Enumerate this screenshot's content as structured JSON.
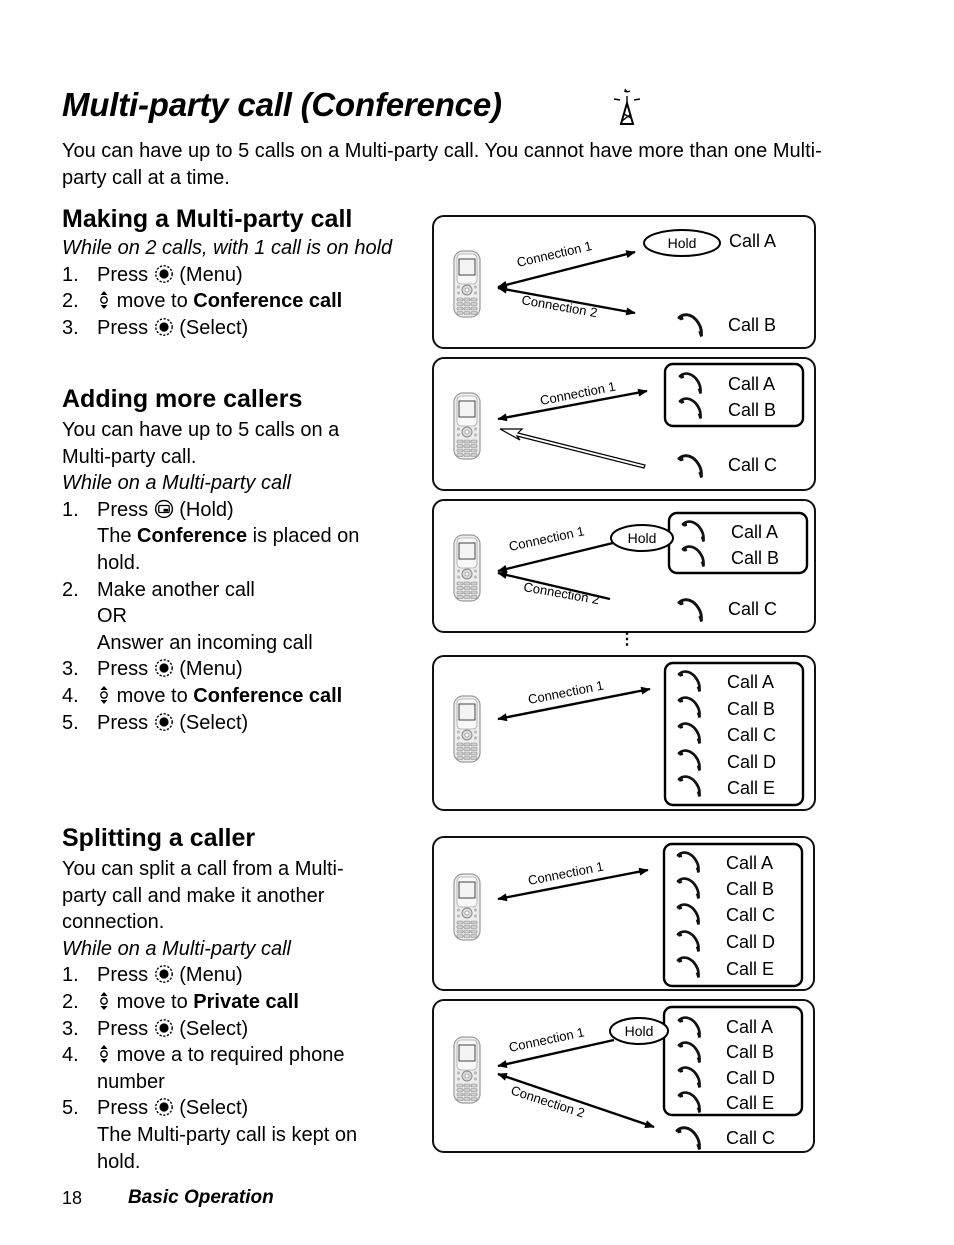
{
  "page": {
    "title": "Multi-party call (Conference)",
    "title_icon": "network-tower-icon",
    "intro": "You can have up to 5 calls on a Multi-party call. You cannot have more than one Multi-party call at a time.",
    "footer": {
      "page_number": "18",
      "section": "Basic Operation"
    }
  },
  "sections": {
    "making": {
      "heading": "Making a Multi-party call",
      "condition": "While on 2 calls, with 1 call is on hold",
      "steps": [
        {
          "num": "1.",
          "pre": "Press",
          "icon": "select-key-icon",
          "post": "(Menu)"
        },
        {
          "num": "2.",
          "icon": "nav-key-icon",
          "pre": "move to",
          "bold": "Conference call"
        },
        {
          "num": "3.",
          "pre": "Press",
          "icon": "select-key-icon",
          "post": "(Select)"
        }
      ]
    },
    "adding": {
      "heading": "Adding more callers",
      "body": "You can have up to 5 calls on a Multi-party call.",
      "condition": "While on a Multi-party call",
      "steps": [
        {
          "num": "1.",
          "pre": "Press",
          "icon": "hold-key-icon",
          "post": "(Hold)",
          "note_pre": "The",
          "note_bold": "Conference",
          "note_post": "is placed on hold."
        },
        {
          "num": "2.",
          "line1": "Make another call",
          "line2": "OR",
          "line3": "Answer an incoming call"
        },
        {
          "num": "3.",
          "pre": "Press",
          "icon": "select-key-icon",
          "post": "(Menu)"
        },
        {
          "num": "4.",
          "icon": "nav-key-icon",
          "pre": "move to",
          "bold": "Conference call"
        },
        {
          "num": "5.",
          "pre": "Press",
          "icon": "select-key-icon",
          "post": "(Select)"
        }
      ]
    },
    "splitting": {
      "heading": "Splitting a caller",
      "body": "You can split a call from a Multi-party call and make it another connection.",
      "condition": "While on a Multi-party call",
      "steps": [
        {
          "num": "1.",
          "pre": "Press",
          "icon": "select-key-icon",
          "post": "(Menu)"
        },
        {
          "num": "2.",
          "icon": "nav-key-icon",
          "pre": "move to",
          "bold": "Private call"
        },
        {
          "num": "3.",
          "pre": "Press",
          "icon": "select-key-icon",
          "post": "(Select)"
        },
        {
          "num": "4.",
          "icon": "nav-key-icon",
          "pre": "move a to required phone number"
        },
        {
          "num": "5.",
          "pre": "Press",
          "icon": "select-key-icon",
          "post": "(Select)",
          "note": "The Multi-party call is kept on hold."
        }
      ]
    }
  },
  "diagrams": [
    {
      "connection1": "Connection 1",
      "connection2": "Connection 2",
      "hold": "Hold",
      "calls": [
        "Call A",
        "Call B"
      ]
    },
    {
      "connection1": "Connection 1",
      "calls": [
        "Call A",
        "Call B",
        "Call C"
      ]
    },
    {
      "connection1": "Connection 1",
      "connection2": "Connection 2",
      "hold": "Hold",
      "calls": [
        "Call A",
        "Call B",
        "Call C"
      ],
      "continuation": "⋮"
    },
    {
      "connection1": "Connection 1",
      "calls": [
        "Call A",
        "Call B",
        "Call C",
        "Call D",
        "Call E"
      ]
    },
    {
      "connection1": "Connection 1",
      "calls": [
        "Call A",
        "Call B",
        "Call C",
        "Call D",
        "Call E"
      ]
    },
    {
      "connection1": "Connection 1",
      "connection2": "Connection 2",
      "hold": "Hold",
      "calls": [
        "Call A",
        "Call B",
        "Call D",
        "Call E",
        "Call C"
      ]
    }
  ]
}
